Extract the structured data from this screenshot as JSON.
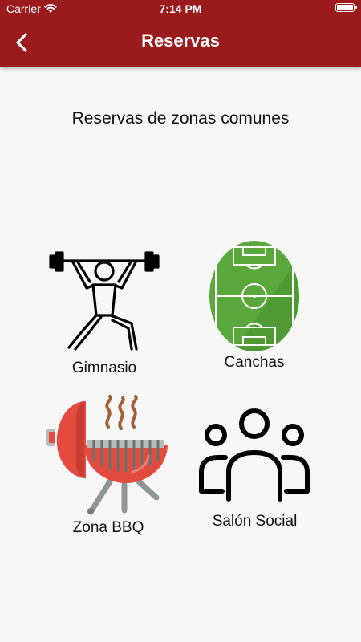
{
  "status_bar": {
    "carrier": "Carrier",
    "time": "7:14 PM"
  },
  "app_bar": {
    "title": "Reservas",
    "back_icon": "chevron-left-icon",
    "background_color": "#9b1b1c"
  },
  "page": {
    "title": "Reservas de zonas comunes"
  },
  "zones": [
    {
      "label": "Gimnasio",
      "icon": "weightlifter-icon"
    },
    {
      "label": "Canchas",
      "icon": "soccer-field-icon"
    },
    {
      "label": "Zona BBQ",
      "icon": "grill-icon"
    },
    {
      "label": "Salón Social",
      "icon": "people-group-icon"
    }
  ],
  "colors": {
    "field_green": "#5aa83c",
    "grill_red": "#e34b3e",
    "background": "#f7f7f7"
  }
}
